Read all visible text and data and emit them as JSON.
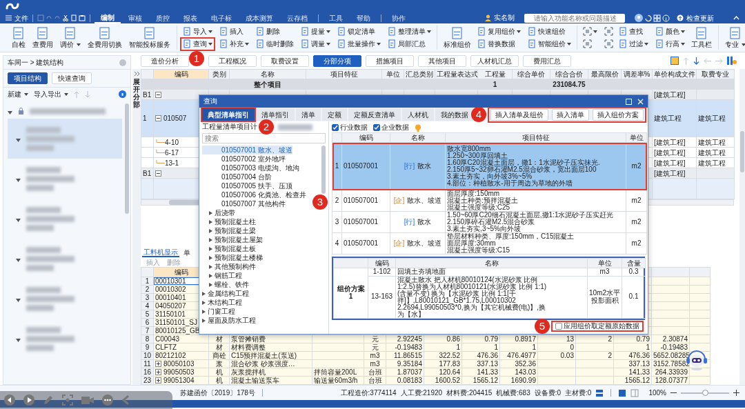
{
  "title_bar": {
    "file_menu": "文件",
    "menu_tabs": [
      {
        "label": "编制",
        "selected": true
      },
      {
        "label": "审核",
        "selected": false
      },
      {
        "label": "质控",
        "selected": false
      },
      {
        "label": "报表",
        "selected": false
      },
      {
        "label": "电子标",
        "selected": false
      },
      {
        "label": "成本测算",
        "selected": false
      },
      {
        "label": "云存档",
        "selected": false
      },
      {
        "label": "工具",
        "selected": false
      },
      {
        "label": "帮助",
        "selected": false
      },
      {
        "label": "协作",
        "selected": false
      }
    ],
    "real_name": "实名制",
    "search": {
      "placeholder": "请输入功能名称或问题描述"
    },
    "update": "检查更新"
  },
  "ribbon": {
    "groups": [
      {
        "sections": [
          {
            "kind": "large",
            "items": [
              {
                "label": "自检",
                "dropdown": false
              },
              {
                "label": "查费用",
                "dropdown": false
              },
              {
                "label": "调价",
                "dropdown": true
              },
              {
                "label": "全费用切换",
                "dropdown": false
              },
              {
                "label": "智能投标服务",
                "dropdown": false
              }
            ]
          }
        ]
      },
      {
        "sections": [
          {
            "kind": "small",
            "items": [
              {
                "label": "导入",
                "dropdown": true
              },
              {
                "label": "查询",
                "dropdown": true,
                "step": "1"
              },
              {
                "label": "插入",
                "dropdown": false
              },
              {
                "label": "补充",
                "dropdown": true
              },
              {
                "label": "删除",
                "dropdown": false
              },
              {
                "label": "临时删除",
                "dropdown": false
              },
              {
                "label": "提量",
                "dropdown": true
              },
              {
                "label": "调量",
                "dropdown": true
              },
              {
                "label": "锁定清单",
                "dropdown": false
              },
              {
                "label": "批量操作",
                "dropdown": true
              },
              {
                "label": "整理清单",
                "dropdown": true
              },
              {
                "label": "局部汇总",
                "dropdown": false
              }
            ]
          }
        ]
      },
      {
        "sections": [
          {
            "kind": "large",
            "items": [
              {
                "label": "标准组价",
                "dropdown": false
              }
            ]
          },
          {
            "kind": "small",
            "items": [
              {
                "label": "复用组价",
                "dropdown": true
              },
              {
                "label": "替换数据",
                "dropdown": false
              },
              {
                "label": "快速组价",
                "dropdown": false
              },
              {
                "label": "智能组价",
                "dropdown": true
              }
            ]
          }
        ]
      },
      {
        "sections": [
          {
            "kind": "icons",
            "items": [
              {
                "dropdown": true
              },
              {
                "dropdown": false
              },
              {
                "dropdown": false
              },
              {
                "dropdown": false
              }
            ]
          },
          {
            "kind": "small",
            "items": [
              {
                "label": "查找",
                "dropdown": false
              },
              {
                "label": "过滤",
                "dropdown": true
              },
              {
                "label": "颜色",
                "dropdown": true
              },
              {
                "label": "行高",
                "dropdown": true
              }
            ]
          },
          {
            "kind": "large",
            "items": [
              {
                "label": "工具栏",
                "dropdown": false
              }
            ]
          }
        ]
      },
      {
        "sections": [
          {
            "kind": "large",
            "items": [
              {
                "label": "专业",
                "dropdown": true
              }
            ]
          }
        ]
      }
    ]
  },
  "left_panel": {
    "breadcrumb": "车间一 > 建筑结构",
    "tabs": [
      {
        "label": "项目结构",
        "selected": true
      },
      {
        "label": "快速查询",
        "selected": false
      }
    ],
    "toolbar": [
      {
        "label": "新建",
        "dropdown": true
      },
      {
        "label": "导入导出",
        "dropdown": true
      }
    ],
    "tree": [
      {
        "expanded": true,
        "selected": false
      },
      {
        "expanded": true,
        "selected": true
      },
      {
        "expanded": true,
        "selected": false
      },
      {
        "expanded": true,
        "selected": false
      },
      {
        "expanded": true,
        "selected": false
      },
      {
        "expanded": true,
        "selected": false
      },
      {
        "expanded": true,
        "selected": false
      }
    ]
  },
  "view_tabs": [
    {
      "label": "造价分析",
      "selected": false
    },
    {
      "label": "工程概况",
      "selected": false
    },
    {
      "label": "取费设置",
      "selected": false
    },
    {
      "label": "分部分项",
      "selected": true
    },
    {
      "label": "措施项目",
      "selected": false
    },
    {
      "label": "其他项目",
      "selected": false
    },
    {
      "label": "人材机汇总",
      "selected": false
    },
    {
      "label": "费用汇总",
      "selected": false
    }
  ],
  "side_strip": "展开分部",
  "top_grid": {
    "columns": [
      "编码",
      "类别",
      "名称",
      "项目特征",
      "单位",
      "汇总类别",
      "工程量表达式",
      "工程量",
      "综合单价",
      "综合合价",
      "最高限价",
      "调差率%",
      "单价构成文件",
      "取费专业"
    ],
    "rows": [
      {
        "kind": "project",
        "name": "整个项目",
        "quantity": "1",
        "total": "231084.75"
      },
      {
        "kind": "section",
        "number": "B1",
        "expanded": true,
        "price_file": "[建筑工程]"
      },
      {
        "kind": "item",
        "number": "1",
        "expanded": true,
        "code": "010507",
        "price_file": "建筑工程",
        "fee_type": "建筑工程",
        "selected": true
      },
      {
        "kind": "sub",
        "code": "4-10",
        "price_file": "[建筑工程]",
        "fee_type": "建筑工程"
      },
      {
        "kind": "sub",
        "code": "6-17",
        "price_file": "[建筑工程]",
        "fee_type": "建筑工程"
      },
      {
        "kind": "sub",
        "code": "13-1",
        "price_file": "[建筑工程]",
        "fee_type": "建筑工程"
      },
      {
        "kind": "section",
        "number": "B1",
        "expanded": true,
        "price_file": "[建筑工程]"
      },
      {
        "kind": "blank"
      }
    ]
  },
  "bottom_pane": {
    "tabs": [
      {
        "label": "工料机显示",
        "selected": true
      },
      {
        "label": "单",
        "selected": false
      }
    ],
    "toolbar": [
      {
        "label": "插入",
        "disabled": true
      },
      {
        "label": "删除",
        "disabled": true
      }
    ],
    "code_column": "编码",
    "rows": [
      {
        "number": "1",
        "code": "00010301",
        "selected": true
      },
      {
        "number": "2",
        "code": "00010302",
        "selected": false
      },
      {
        "number": "3",
        "code": "00010401",
        "selected": false
      },
      {
        "number": "4",
        "code": "04050207",
        "selected": false
      },
      {
        "number": "5",
        "code": "31150101",
        "selected": false
      },
      {
        "number": "6",
        "code": "31150101_SJ",
        "selected": false
      },
      {
        "number": "7",
        "code": "80010125_GB",
        "selected": false
      },
      {
        "number": "8",
        "code": "C00043",
        "type": "材",
        "name": "泵管摊销费",
        "unit": "元",
        "values": {
          "v1": "2.92245",
          "v2": "0.86",
          "v3": "0.79",
          "v4": "0.8917",
          "v5": "13",
          "v6": "2",
          "v7": "0.79",
          "v8": "2.30874"
        },
        "selected": false
      },
      {
        "number": "9",
        "code": "CLFTZ",
        "type": "材",
        "name": "材料费调整",
        "unit": "元",
        "values": {
          "v1": "-0.19483",
          "v2": "1",
          "v3": "1",
          "v4": "1",
          "v5": "0",
          "v7": "1",
          "v8": "-0.19483"
        },
        "selected": false
      },
      {
        "number": "10",
        "code": "80212102",
        "type": "商砼",
        "name": "C15预拌混凝土(泵送)",
        "unit": "m3",
        "values": {
          "v1": "11.86515",
          "v2": "322.52",
          "v3": "476.36",
          "v4": "476.4977",
          "v5": "0.03",
          "v6": "2",
          "v7": "476.36",
          "v8": "5652.08285"
        },
        "selected": false
      },
      {
        "number": "11",
        "expanded": false,
        "code": "80050103",
        "type": "浆",
        "name": "混合砂浆 砂浆强度…",
        "unit": "m3",
        "values": {
          "v1": "9.35184",
          "v2": "177.83",
          "v3": "337.13",
          "v4": "352.36",
          "v7": "337.13",
          "v8": "3152.78582"
        },
        "selected": false
      },
      {
        "number": "16",
        "expanded": false,
        "code": "99050503",
        "type": "机",
        "name": "灰浆搅拌机",
        "spec": "拌筒容量200L",
        "unit": "台班",
        "values": {
          "v1": "1.87037",
          "v2": "120.64",
          "v3": "141.33",
          "v4": "143.03",
          "v7": "141.33",
          "v8": "264.33939"
        },
        "selected": false
      },
      {
        "number": "23",
        "expanded": false,
        "code": "99051304",
        "type": "机",
        "name": "混凝土输送泵车",
        "spec": "输送量60m3/h",
        "unit": "台班",
        "values": {
          "v1": "0.08183",
          "v2": "1600.52",
          "v3": "1565.12",
          "v4": "1690.99",
          "v7": "1565.12",
          "v8": "128.07377"
        },
        "selected": false
      }
    ]
  },
  "dialog": {
    "title": "查询",
    "tabs": [
      {
        "label": "典型清单指引",
        "selected": true,
        "step": "2"
      },
      {
        "label": "清单指引",
        "selected": false
      },
      {
        "label": "清单",
        "selected": false
      },
      {
        "label": "定额",
        "selected": false
      },
      {
        "label": "定额反查清单",
        "selected": false
      },
      {
        "label": "人材机",
        "selected": false
      },
      {
        "label": "我的数据",
        "selected": false
      }
    ],
    "actions": {
      "step": "4",
      "buttons": [
        "插入清单及组价",
        "插入清单",
        "插入组价方案"
      ]
    },
    "library": "工程量清单项目计",
    "search": {
      "placeholder": "搜索"
    },
    "tree": [
      {
        "children": [
          {
            "children": [
              {
                "label": "010507001 散水、坡道",
                "selected": true
              },
              {
                "label": "010507002 室外地坪",
                "selected": false
              },
              {
                "label": "010507003 电缆沟、地沟",
                "selected": false
              },
              {
                "label": "010507004 台阶",
                "selected": false
              },
              {
                "label": "010507005 扶手、压顶",
                "selected": false
              },
              {
                "label": "010507006 化粪池、检查井",
                "selected": false
              },
              {
                "label": "010507007 其他构件",
                "selected": false
              }
            ]
          },
          {
            "label": "后浇带",
            "expanded": false
          },
          {
            "label": "预制混凝土柱",
            "expanded": false
          },
          {
            "label": "预制混凝土梁",
            "expanded": false
          },
          {
            "label": "预制混凝土屋架",
            "expanded": false
          },
          {
            "label": "预制混凝土板",
            "expanded": false
          },
          {
            "label": "预制混凝土楼梯",
            "expanded": false
          },
          {
            "label": "其他预制构件",
            "expanded": false
          },
          {
            "label": "钢筋工程",
            "expanded": false
          },
          {
            "label": "螺栓、铁件",
            "expanded": false
          }
        ]
      },
      {
        "label": "金属结构工程",
        "expanded": false
      },
      {
        "label": "木结构工程",
        "expanded": false
      },
      {
        "label": "门窗工程",
        "expanded": false
      },
      {
        "label": "屋面及防水工程",
        "expanded": false
      }
    ],
    "filters": [
      {
        "label": "行业数据",
        "checked": true
      },
      {
        "label": "企业数据",
        "checked": true
      }
    ],
    "list": {
      "columns": [
        "编码",
        "名称",
        "项目特征",
        "单位"
      ],
      "step": "3",
      "rows": [
        {
          "number": "1",
          "code": "010507001",
          "tag": "[行]",
          "kind": "industry",
          "name": "散水",
          "features": [
            "散水宽800mm",
            "1.250~300厚回填土",
            "1.60厚C20混凝土面层，撒1：1水泥砂子压实抹光.",
            "2.150厚5~32卵石灌M2.5混合砂浆，宽出面层100",
            "3.素土夯实，向外坡3%~5%",
            "4.部位：种植散水-用于周边为草地的外墙"
          ],
          "unit": "m2",
          "selected": true
        },
        {
          "number": "2",
          "code": "010507001",
          "tag": "[企]",
          "kind": "enterprise",
          "name": "散水、坡道",
          "features": [
            "面层厚度:150mm",
            "混凝土种类:预拌混凝土",
            "混凝土强度等级:C25"
          ],
          "unit": "m2",
          "selected": false
        },
        {
          "number": "3",
          "code": "010507001",
          "tag": "[行]",
          "kind": "industry",
          "name": "散水",
          "features": [
            "1.50~60厚C20细石混凝土面层,撒1:1水泥砂子压实赶光",
            "2.150厚碎石灌M2.5混合砂浆",
            "3.素土夯实,3~5%向外坡"
          ],
          "unit": "m2",
          "selected": false
        },
        {
          "number": "4",
          "code": "010507001",
          "tag": "[企]",
          "kind": "enterprise",
          "name": "散水、坡道",
          "features": [
            "垫层材料种类、厚度:150mm，C15混凝土",
            "面层厚度:30mm",
            "混凝土强度等级:C15"
          ],
          "unit": "m2",
          "selected": false
        }
      ]
    },
    "plan": {
      "columns": [
        "编码",
        "名称",
        "单位",
        "含量"
      ],
      "label": "组价方案1",
      "rows": [
        {
          "code": "1-102",
          "name": [
            "回填土夯填地面"
          ],
          "unit": "m3",
          "amount": "0.3"
        },
        {
          "code": "13-163",
          "name": [
            "混凝土散水  把人材机80010124(水泥砂浆 比例",
            "1:2.5)替换为人材机80010121(水泥砂浆 比例 1:1)",
            "(含量不变)  换为【水泥砂浆 比例 1:1[干",
            "拌]】,L80010121_GB*1.75,L00010302",
            "2.2694,L99050503*0,换为【其它机械费(电)】,换",
            "为【水】"
          ],
          "unit": "10m2水平投影面积",
          "amount": "0.1"
        }
      ]
    },
    "apply_original": {
      "label": "应用组价取定额原始数据",
      "checked": false,
      "step": "5"
    }
  },
  "status_bar": {
    "standard": "苏建函价〔2019〕178号",
    "totals": [
      "工程造价:3774114",
      "人工费:21920",
      "材料费:204415",
      "机械费:683",
      "设备费:0",
      "主材费:0"
    ],
    "zoom": "100%",
    "zoom_slider": {
      "level": 0.5
    }
  }
}
